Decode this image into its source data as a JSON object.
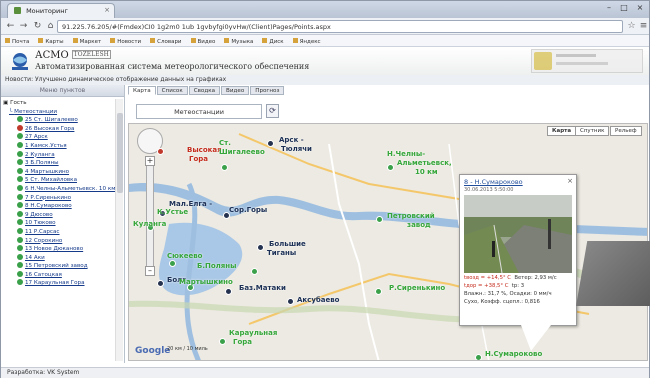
{
  "browser": {
    "tab_title": "Мониторинг",
    "url": "91.225.76.205/#(Fmdex)CI0 1g2m0 1ub 1gvbyfgi0yvHw/(Client)Pages/Points.aspx"
  },
  "bookmarks": [
    "Почта",
    "Карты",
    "Маркет",
    "Новости",
    "Словари",
    "Видео",
    "Музыка",
    "Диск",
    "Яндекс"
  ],
  "header": {
    "brand": "АСМО",
    "brand_tag": "TOZELESH",
    "subtitle": "Автоматизированная система метеорологического обеспечения"
  },
  "news": "Новости: Улучшено динамическое отображение данных на графиках",
  "sidebar": {
    "header": "Меню пунктов",
    "root": "Гость",
    "group": "Метеостанции",
    "items": [
      {
        "label": "25 Ст. Шигалеево",
        "status": "green"
      },
      {
        "label": "26 Высокая Гора",
        "status": "red"
      },
      {
        "label": "27 Арск",
        "status": "green"
      },
      {
        "label": "1 Камск.Устья",
        "status": "green"
      },
      {
        "label": "2 Куланга",
        "status": "green"
      },
      {
        "label": "3 Б.Поляны",
        "status": "green"
      },
      {
        "label": "4 Мартышкино",
        "status": "green"
      },
      {
        "label": "5 Ст. Михайловка",
        "status": "green"
      },
      {
        "label": "6 Н.Челны-Альметьевск. 10 км",
        "status": "green"
      },
      {
        "label": "7 Р.Сиренькино",
        "status": "green"
      },
      {
        "label": "8 Н.Сумароково",
        "status": "green"
      },
      {
        "label": "9 Дюсово",
        "status": "green"
      },
      {
        "label": "10 Тюково",
        "status": "green"
      },
      {
        "label": "11 Р.Сарсас",
        "status": "green"
      },
      {
        "label": "12 Сорокино",
        "status": "green"
      },
      {
        "label": "13 Новое Дюканово",
        "status": "green"
      },
      {
        "label": "14 Аки",
        "status": "green"
      },
      {
        "label": "15 Петровский завод",
        "status": "green"
      },
      {
        "label": "16 Сатоцкая",
        "status": "green"
      },
      {
        "label": "17 Караульная Гора",
        "status": "green"
      }
    ]
  },
  "main": {
    "tabs": [
      "Карта",
      "Список",
      "Сводка",
      "Видео",
      "Прогноз"
    ],
    "station_select": "Метеостанции",
    "refresh_icon": "refresh-icon"
  },
  "map": {
    "types": [
      "Карта",
      "Спутник",
      "Рельеф"
    ],
    "labels": [
      {
        "text": "Арск -",
        "kind": "dark"
      },
      {
        "text": "Тюлячи",
        "kind": "dark"
      },
      {
        "text": "Высокая",
        "kind": "red"
      },
      {
        "text": "Гора",
        "kind": "red"
      },
      {
        "text": "Ст.",
        "kind": "green"
      },
      {
        "text": "Шигалеево",
        "kind": "green"
      },
      {
        "text": "Мал.Елга -",
        "kind": "dark"
      },
      {
        "text": "Сор.Горы",
        "kind": "dark"
      },
      {
        "text": "К.Устье",
        "kind": "green"
      },
      {
        "text": "Куланга",
        "kind": "green"
      },
      {
        "text": "Большие",
        "kind": "dark"
      },
      {
        "text": "Тиганы",
        "kind": "dark"
      },
      {
        "text": "Сюкеево",
        "kind": "green"
      },
      {
        "text": "Б.Поляны",
        "kind": "green"
      },
      {
        "text": "Болг",
        "kind": "dark"
      },
      {
        "text": "Мартышкино",
        "kind": "green"
      },
      {
        "text": "Баз.Матаки",
        "kind": "dark"
      },
      {
        "text": "Аксубаево",
        "kind": "dark"
      },
      {
        "text": "Н.Челны-",
        "kind": "green"
      },
      {
        "text": "Альметьевск,",
        "kind": "green"
      },
      {
        "text": "10 км",
        "kind": "green"
      },
      {
        "text": "Петровский",
        "kind": "green"
      },
      {
        "text": "завод",
        "kind": "green"
      },
      {
        "text": "Р.Сиренькино",
        "kind": "green"
      },
      {
        "text": "Н.Сумароково",
        "kind": "green"
      },
      {
        "text": "Караульная",
        "kind": "green"
      },
      {
        "text": "Гора",
        "kind": "green"
      }
    ],
    "popup": {
      "title": "8 - Н.Сумароково",
      "date": "30.06.2013 5:50:00",
      "temp_air": "+14,5° С",
      "wind": "Ветер: 2,93 м/с",
      "temp_road": "+38,5° С",
      "dew": "3",
      "humidity": "Влажн.: 31,7 %, Осадки: 0 мм/ч",
      "grip": "Сухо, Коэфф. сцепл.: 0,816"
    },
    "scale_km": "20 км",
    "scale_mi": "10 миль"
  },
  "status_bar": "Разработка: VK System"
}
